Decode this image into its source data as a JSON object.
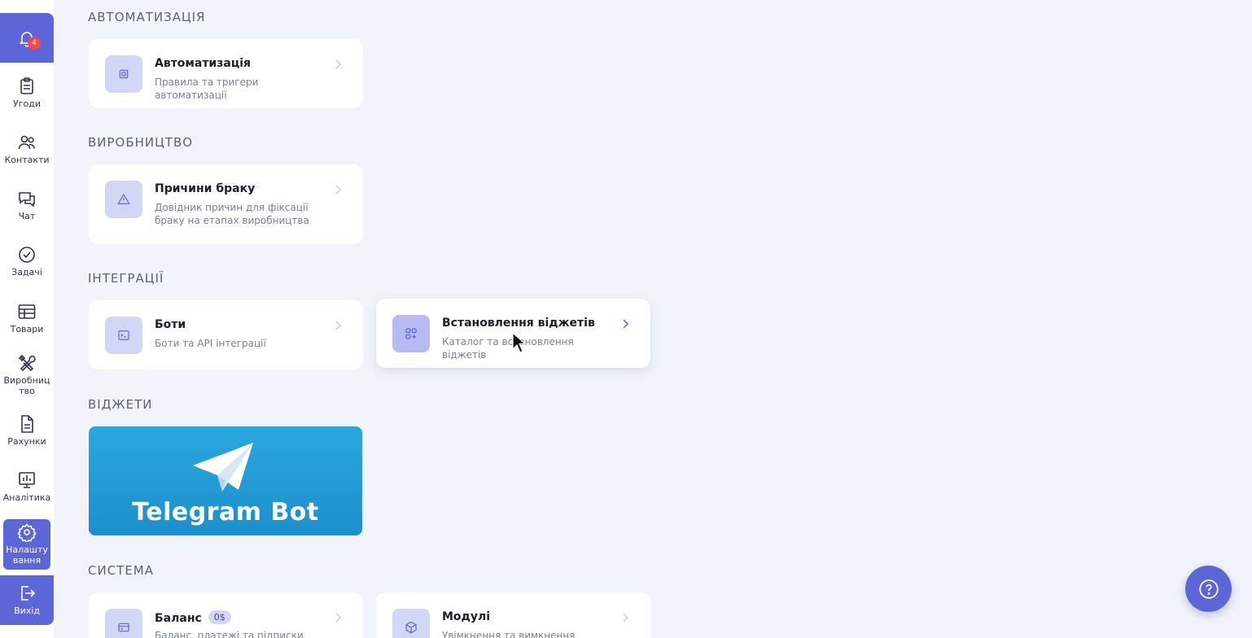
{
  "sidebar": {
    "notifications_count": "4",
    "items": [
      {
        "label": "Угоди",
        "icon": "clipboard-icon"
      },
      {
        "label": "Контакти",
        "icon": "users-icon"
      },
      {
        "label": "Чат",
        "icon": "chat-icon"
      },
      {
        "label": "Задачі",
        "icon": "check-circle-icon"
      },
      {
        "label": "Товари",
        "icon": "table-icon"
      },
      {
        "label": "Виробництво",
        "icon": "tools-icon"
      },
      {
        "label": "Рахунки",
        "icon": "document-icon"
      },
      {
        "label": "Аналітика",
        "icon": "chart-icon"
      },
      {
        "label": "Налаштування",
        "icon": "gear-icon"
      }
    ],
    "logout_label": "Вихід",
    "accent_color": "#5c66d6"
  },
  "sections": {
    "automation": {
      "title": "АВТОМАТИЗАЦІЯ",
      "card": {
        "title": "Автоматизація",
        "subtitle": "Правила та тригери автоматизації",
        "icon": "chip-icon"
      }
    },
    "production": {
      "title": "ВИРОБНИЦТВО",
      "card": {
        "title": "Причини браку",
        "subtitle": "Довідник причин для фіксації браку на етапах виробництва",
        "icon": "warning-icon"
      }
    },
    "integrations": {
      "title": "ІНТЕГРАЦІЇ",
      "bots": {
        "title": "Боти",
        "subtitle": "Боти та API інтеграції",
        "icon": "terminal-icon"
      },
      "widgets_install": {
        "title": "Встановлення віджетів",
        "subtitle": "Каталог та встановлення віджетів",
        "icon": "apps-add-icon"
      }
    },
    "widgets": {
      "title": "ВІДЖЕТИ",
      "telegram_banner": "Telegram Bot"
    },
    "system": {
      "title": "СИСТЕМА",
      "balance": {
        "title": "Баланс",
        "badge": "0$",
        "subtitle": "Баланс, платежі та підписки",
        "icon": "card-icon"
      },
      "modules": {
        "title": "Модулі",
        "subtitle": "Увімкнення та вимкнення модулів",
        "icon": "cube-icon"
      }
    }
  }
}
